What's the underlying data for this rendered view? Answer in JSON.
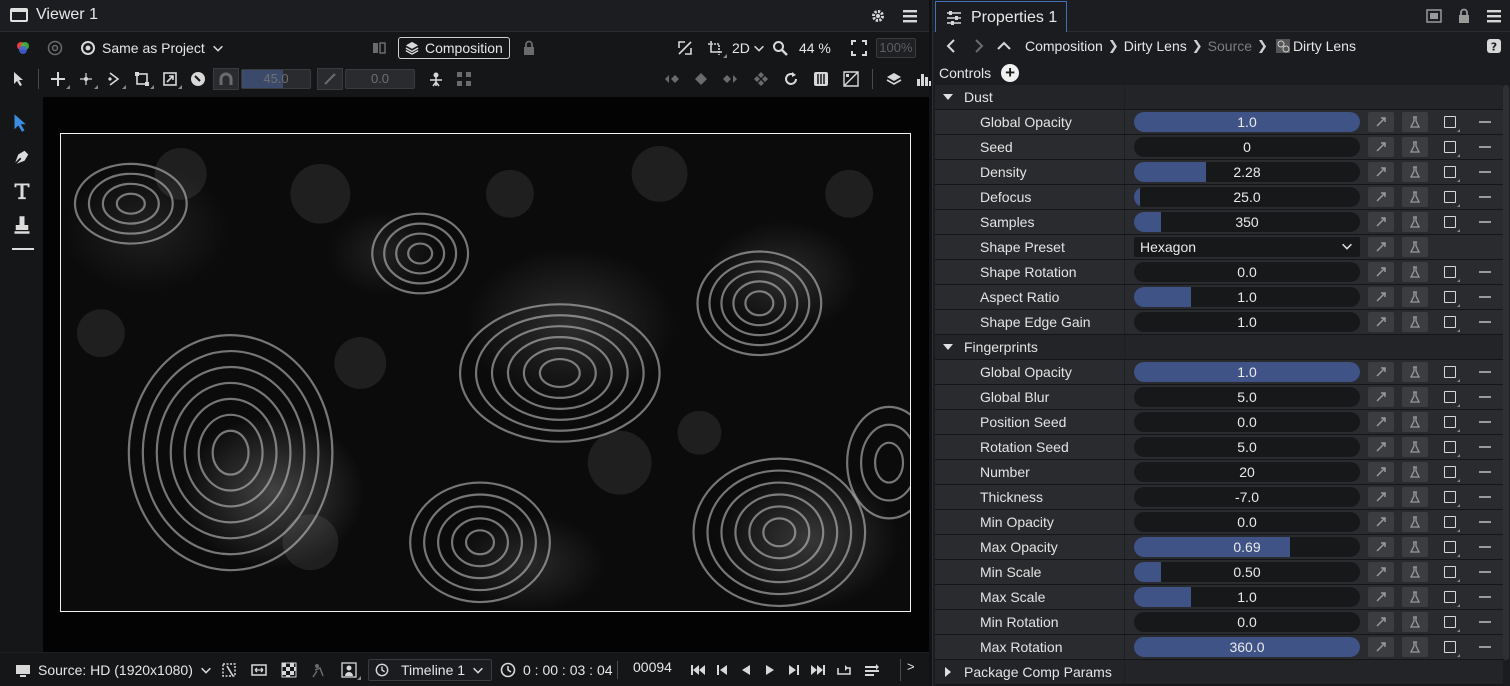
{
  "viewer": {
    "title": "Viewer 1",
    "color_space": "Same as Project",
    "composition_label": "Composition",
    "view_mode": "2D",
    "zoom": "44 %",
    "zoom_disabled": "100%",
    "rotate_value": "45.0",
    "skew_value": "0.0",
    "source": "Source: HD (1920x1080)",
    "timeline": "Timeline 1",
    "timecode": "0 : 00 : 03 : 04",
    "frame": "00094",
    "more": ">"
  },
  "properties": {
    "title": "Properties 1",
    "breadcrumb": [
      "Composition",
      "Dirty Lens",
      "Source",
      "Dirty Lens"
    ],
    "controls_label": "Controls",
    "groups": [
      {
        "name": "Dust",
        "expanded": true,
        "rows": [
          {
            "name": "Global Opacity",
            "type": "slider",
            "value": "1.0",
            "fill": 1.0,
            "check": true
          },
          {
            "name": "Seed",
            "type": "slider",
            "value": "0",
            "fill": 0.0,
            "check": true
          },
          {
            "name": "Density",
            "type": "slider",
            "value": "2.28",
            "fill": 0.32,
            "check": true
          },
          {
            "name": "Defocus",
            "type": "slider",
            "value": "25.0",
            "fill": 0.025,
            "check": true
          },
          {
            "name": "Samples",
            "type": "slider",
            "value": "350",
            "fill": 0.12,
            "check": true
          },
          {
            "name": "Shape Preset",
            "type": "dropdown",
            "value": "Hexagon",
            "check": false
          },
          {
            "name": "Shape Rotation",
            "type": "slider",
            "value": "0.0",
            "fill": 0.0,
            "check": true
          },
          {
            "name": "Aspect Ratio",
            "type": "slider",
            "value": "1.0",
            "fill": 0.25,
            "check": true
          },
          {
            "name": "Shape Edge Gain",
            "type": "slider",
            "value": "1.0",
            "fill": 0.0,
            "check": true
          }
        ]
      },
      {
        "name": "Fingerprints",
        "expanded": true,
        "rows": [
          {
            "name": "Global Opacity",
            "type": "slider",
            "value": "1.0",
            "fill": 1.0,
            "check": true
          },
          {
            "name": "Global Blur",
            "type": "slider",
            "value": "5.0",
            "fill": 0.0,
            "check": true
          },
          {
            "name": "Position Seed",
            "type": "slider",
            "value": "0.0",
            "fill": 0.0,
            "check": true
          },
          {
            "name": "Rotation Seed",
            "type": "slider",
            "value": "5.0",
            "fill": 0.0,
            "check": true
          },
          {
            "name": "Number",
            "type": "slider",
            "value": "20",
            "fill": 0.0,
            "check": true
          },
          {
            "name": "Thickness",
            "type": "slider",
            "value": "-7.0",
            "fill": 0.0,
            "check": true
          },
          {
            "name": "Min Opacity",
            "type": "slider",
            "value": "0.0",
            "fill": 0.0,
            "check": true
          },
          {
            "name": "Max Opacity",
            "type": "slider",
            "value": "0.69",
            "fill": 0.69,
            "check": true
          },
          {
            "name": "Min Scale",
            "type": "slider",
            "value": "0.50",
            "fill": 0.12,
            "check": true
          },
          {
            "name": "Max Scale",
            "type": "slider",
            "value": "1.0",
            "fill": 0.25,
            "check": true
          },
          {
            "name": "Min Rotation",
            "type": "slider",
            "value": "0.0",
            "fill": 0.0,
            "check": true
          },
          {
            "name": "Max Rotation",
            "type": "slider",
            "value": "360.0",
            "fill": 1.0,
            "check": true
          }
        ]
      },
      {
        "name": "Package Comp Params",
        "expanded": false,
        "rows": []
      }
    ]
  },
  "colors": {
    "accent": "#3f71b8",
    "slider_fill": "#3f5387",
    "background": "#151618"
  }
}
